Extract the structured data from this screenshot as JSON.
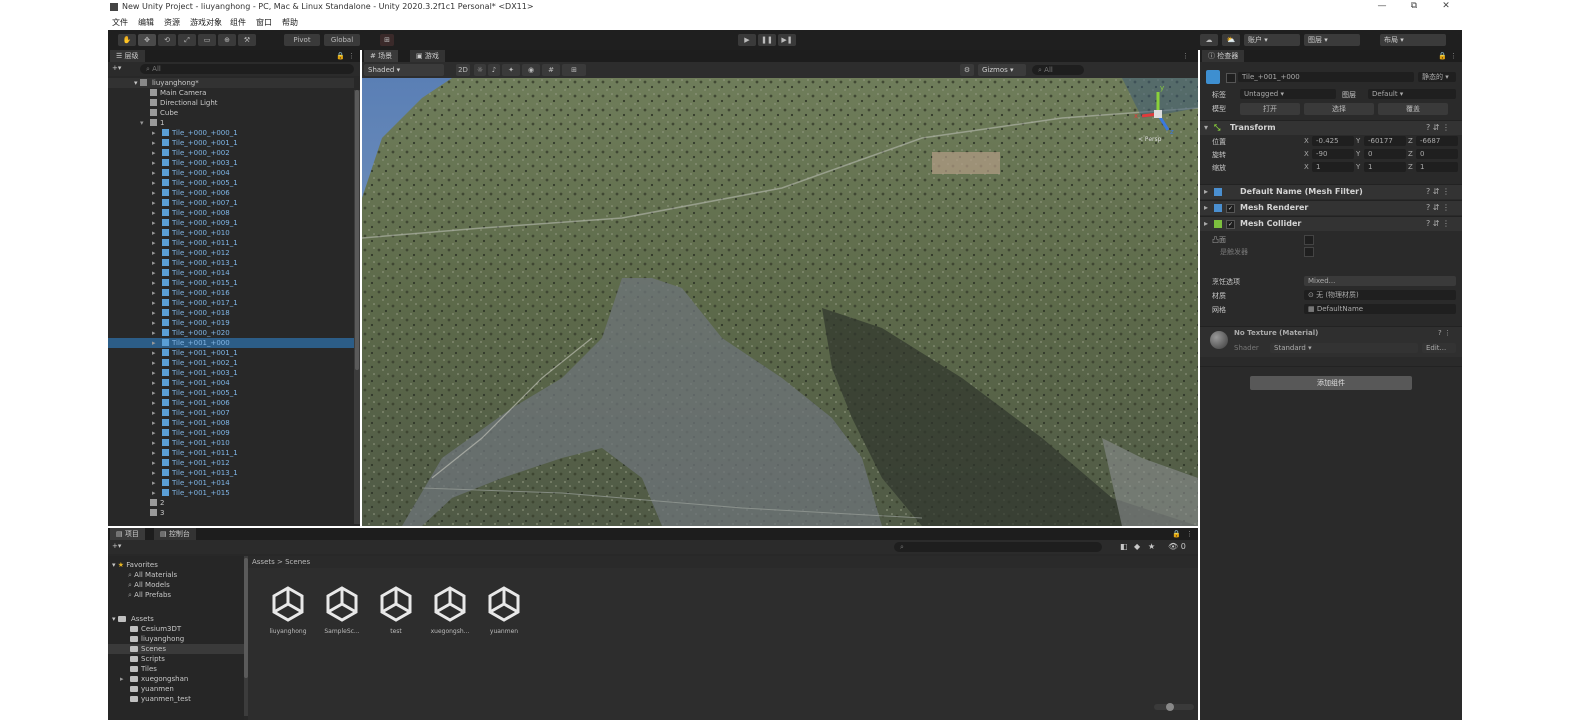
{
  "window": {
    "title": "New Unity Project - liuyanghong - PC, Mac & Linux Standalone - Unity 2020.3.2f1c1 Personal* <DX11>",
    "controls": [
      "—",
      "⧉",
      "✕"
    ]
  },
  "menu": [
    "文件",
    "编辑",
    "资源",
    "游戏对象",
    "组件",
    "窗口",
    "帮助"
  ],
  "toolbar": {
    "tools": [
      "✋",
      "✥",
      "⟲",
      "⤢",
      "▭",
      "⊕",
      "⚒"
    ],
    "pivot_label": "Pivot",
    "space_label": "Global",
    "play": "▶",
    "pause": "❚❚",
    "step": "▶❚",
    "account_label": "账户",
    "layers_label": "图层",
    "layout_label": "布局"
  },
  "hierarchy": {
    "tab": "层级",
    "add": "+▾",
    "search_placeholder": "All",
    "scene_name": "liuyanghong*",
    "rows": [
      {
        "label": "Main Camera",
        "depth": 2,
        "kind": "obj",
        "selected": false
      },
      {
        "label": "Directional Light",
        "depth": 2,
        "kind": "obj",
        "selected": false
      },
      {
        "label": "Cube",
        "depth": 2,
        "kind": "obj",
        "selected": false
      },
      {
        "label": "1",
        "depth": 2,
        "kind": "obj",
        "selected": false
      },
      {
        "label": "Tile_+000_+000_1",
        "depth": 3,
        "kind": "tile",
        "selected": false
      },
      {
        "label": "Tile_+000_+001_1",
        "depth": 3,
        "kind": "tile",
        "selected": false
      },
      {
        "label": "Tile_+000_+002",
        "depth": 3,
        "kind": "tile",
        "selected": false
      },
      {
        "label": "Tile_+000_+003_1",
        "depth": 3,
        "kind": "tile",
        "selected": false
      },
      {
        "label": "Tile_+000_+004",
        "depth": 3,
        "kind": "tile",
        "selected": false
      },
      {
        "label": "Tile_+000_+005_1",
        "depth": 3,
        "kind": "tile",
        "selected": false
      },
      {
        "label": "Tile_+000_+006",
        "depth": 3,
        "kind": "tile",
        "selected": false
      },
      {
        "label": "Tile_+000_+007_1",
        "depth": 3,
        "kind": "tile",
        "selected": false
      },
      {
        "label": "Tile_+000_+008",
        "depth": 3,
        "kind": "tile",
        "selected": false
      },
      {
        "label": "Tile_+000_+009_1",
        "depth": 3,
        "kind": "tile",
        "selected": false
      },
      {
        "label": "Tile_+000_+010",
        "depth": 3,
        "kind": "tile",
        "selected": false
      },
      {
        "label": "Tile_+000_+011_1",
        "depth": 3,
        "kind": "tile",
        "selected": false
      },
      {
        "label": "Tile_+000_+012",
        "depth": 3,
        "kind": "tile",
        "selected": false
      },
      {
        "label": "Tile_+000_+013_1",
        "depth": 3,
        "kind": "tile",
        "selected": false
      },
      {
        "label": "Tile_+000_+014",
        "depth": 3,
        "kind": "tile",
        "selected": false
      },
      {
        "label": "Tile_+000_+015_1",
        "depth": 3,
        "kind": "tile",
        "selected": false
      },
      {
        "label": "Tile_+000_+016",
        "depth": 3,
        "kind": "tile",
        "selected": false
      },
      {
        "label": "Tile_+000_+017_1",
        "depth": 3,
        "kind": "tile",
        "selected": false
      },
      {
        "label": "Tile_+000_+018",
        "depth": 3,
        "kind": "tile",
        "selected": false
      },
      {
        "label": "Tile_+000_+019",
        "depth": 3,
        "kind": "tile",
        "selected": false
      },
      {
        "label": "Tile_+000_+020",
        "depth": 3,
        "kind": "tile",
        "selected": false
      },
      {
        "label": "Tile_+001_+000",
        "depth": 3,
        "kind": "tile",
        "selected": true
      },
      {
        "label": "Tile_+001_+001_1",
        "depth": 3,
        "kind": "tile",
        "selected": false
      },
      {
        "label": "Tile_+001_+002_1",
        "depth": 3,
        "kind": "tile",
        "selected": false
      },
      {
        "label": "Tile_+001_+003_1",
        "depth": 3,
        "kind": "tile",
        "selected": false
      },
      {
        "label": "Tile_+001_+004",
        "depth": 3,
        "kind": "tile",
        "selected": false
      },
      {
        "label": "Tile_+001_+005_1",
        "depth": 3,
        "kind": "tile",
        "selected": false
      },
      {
        "label": "Tile_+001_+006",
        "depth": 3,
        "kind": "tile",
        "selected": false
      },
      {
        "label": "Tile_+001_+007",
        "depth": 3,
        "kind": "tile",
        "selected": false
      },
      {
        "label": "Tile_+001_+008",
        "depth": 3,
        "kind": "tile",
        "selected": false
      },
      {
        "label": "Tile_+001_+009",
        "depth": 3,
        "kind": "tile",
        "selected": false
      },
      {
        "label": "Tile_+001_+010",
        "depth": 3,
        "kind": "tile",
        "selected": false
      },
      {
        "label": "Tile_+001_+011_1",
        "depth": 3,
        "kind": "tile",
        "selected": false
      },
      {
        "label": "Tile_+001_+012",
        "depth": 3,
        "kind": "tile",
        "selected": false
      },
      {
        "label": "Tile_+001_+013_1",
        "depth": 3,
        "kind": "tile",
        "selected": false
      },
      {
        "label": "Tile_+001_+014",
        "depth": 3,
        "kind": "tile",
        "selected": false
      },
      {
        "label": "Tile_+001_+015",
        "depth": 3,
        "kind": "tile",
        "selected": false
      },
      {
        "label": "2",
        "depth": 2,
        "kind": "obj",
        "selected": false
      },
      {
        "label": "3",
        "depth": 2,
        "kind": "obj",
        "selected": false
      }
    ]
  },
  "scene": {
    "tabs": [
      "场景",
      "游戏"
    ],
    "shading": "Shaded",
    "mode_2d": "2D",
    "gizmos": "Gizmos",
    "search_placeholder": "All",
    "gizmo_axes": [
      "y",
      "x",
      "z"
    ],
    "persp_label": "< Persp"
  },
  "inspector": {
    "tab": "检查器",
    "object_name": "Tile_+001_+000",
    "static_label": "静态的",
    "tag_label": "标签",
    "tag_value": "Untagged",
    "layer_label": "图层",
    "layer_value": "Default",
    "model_label": "模型",
    "open_label": "打开",
    "select_label": "选择",
    "overrides_label": "覆盖",
    "transform": {
      "title": "Transform",
      "rows": [
        {
          "label": "位置",
          "x": "-0.425",
          "y": "-60177",
          "z": "-6687"
        },
        {
          "label": "旋转",
          "x": "-90",
          "y": "0",
          "z": "0"
        },
        {
          "label": "缩放",
          "x": "1",
          "y": "1",
          "z": "1"
        }
      ]
    },
    "components": [
      {
        "name": "Default Name (Mesh Filter)",
        "icon_color": "#4a8fd0"
      },
      {
        "name": "Mesh Renderer",
        "icon_color": "#4a8fd0"
      },
      {
        "name": "Mesh Collider",
        "icon_color": "#7cbf3e"
      }
    ],
    "collider": {
      "convex_label": "凸面",
      "trigger_label": "是触发器",
      "cooking_label": "烹饪选项",
      "cooking_value": "Mixed...",
      "material_label": "材质",
      "material_value": "无 (物理材质)",
      "mesh_label": "网格",
      "mesh_value": "DefaultName"
    },
    "material": {
      "name": "No Texture (Material)",
      "shader_label": "Shader",
      "shader_value": "Standard",
      "edit_label": "Edit..."
    },
    "add_component": "添加组件"
  },
  "project": {
    "tabs": [
      "项目",
      "控制台"
    ],
    "add": "+▾",
    "favorites_label": "Favorites",
    "favorites": [
      "All Materials",
      "All Models",
      "All Prefabs"
    ],
    "assets_label": "Assets",
    "folders": [
      {
        "label": "Cesium3DT",
        "selected": false
      },
      {
        "label": "liuyanghong",
        "selected": false
      },
      {
        "label": "Scenes",
        "selected": true
      },
      {
        "label": "Scripts",
        "selected": false
      },
      {
        "label": "Tiles",
        "selected": false
      },
      {
        "label": "xuegongshan",
        "selected": false
      },
      {
        "label": "yuanmen",
        "selected": false
      },
      {
        "label": "yuanmen_test",
        "selected": false
      }
    ],
    "breadcrumb": "Assets > Scenes",
    "assets": [
      "liuyanghong",
      "SampleSc...",
      "test",
      "xuegongsh...",
      "yuanmen"
    ]
  }
}
